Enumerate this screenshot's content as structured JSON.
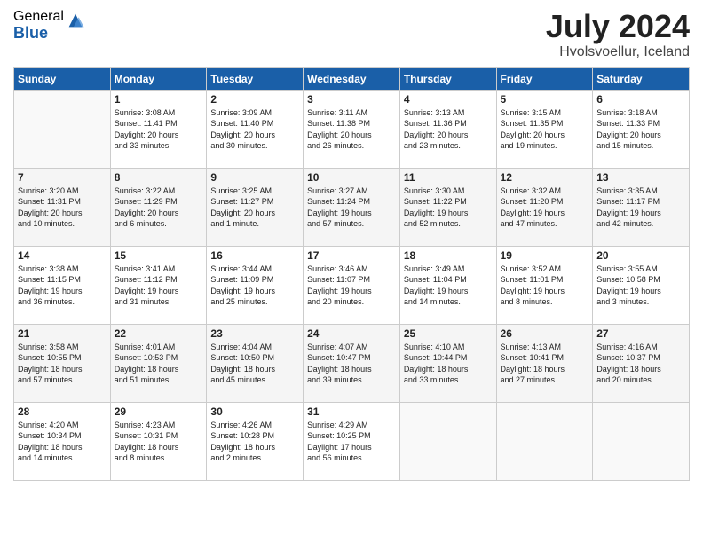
{
  "logo": {
    "general": "General",
    "blue": "Blue"
  },
  "header": {
    "month_year": "July 2024",
    "location": "Hvolsvoellur, Iceland"
  },
  "days_of_week": [
    "Sunday",
    "Monday",
    "Tuesday",
    "Wednesday",
    "Thursday",
    "Friday",
    "Saturday"
  ],
  "weeks": [
    [
      {
        "day": "",
        "info": ""
      },
      {
        "day": "1",
        "info": "Sunrise: 3:08 AM\nSunset: 11:41 PM\nDaylight: 20 hours\nand 33 minutes."
      },
      {
        "day": "2",
        "info": "Sunrise: 3:09 AM\nSunset: 11:40 PM\nDaylight: 20 hours\nand 30 minutes."
      },
      {
        "day": "3",
        "info": "Sunrise: 3:11 AM\nSunset: 11:38 PM\nDaylight: 20 hours\nand 26 minutes."
      },
      {
        "day": "4",
        "info": "Sunrise: 3:13 AM\nSunset: 11:36 PM\nDaylight: 20 hours\nand 23 minutes."
      },
      {
        "day": "5",
        "info": "Sunrise: 3:15 AM\nSunset: 11:35 PM\nDaylight: 20 hours\nand 19 minutes."
      },
      {
        "day": "6",
        "info": "Sunrise: 3:18 AM\nSunset: 11:33 PM\nDaylight: 20 hours\nand 15 minutes."
      }
    ],
    [
      {
        "day": "7",
        "info": "Sunrise: 3:20 AM\nSunset: 11:31 PM\nDaylight: 20 hours\nand 10 minutes."
      },
      {
        "day": "8",
        "info": "Sunrise: 3:22 AM\nSunset: 11:29 PM\nDaylight: 20 hours\nand 6 minutes."
      },
      {
        "day": "9",
        "info": "Sunrise: 3:25 AM\nSunset: 11:27 PM\nDaylight: 20 hours\nand 1 minute."
      },
      {
        "day": "10",
        "info": "Sunrise: 3:27 AM\nSunset: 11:24 PM\nDaylight: 19 hours\nand 57 minutes."
      },
      {
        "day": "11",
        "info": "Sunrise: 3:30 AM\nSunset: 11:22 PM\nDaylight: 19 hours\nand 52 minutes."
      },
      {
        "day": "12",
        "info": "Sunrise: 3:32 AM\nSunset: 11:20 PM\nDaylight: 19 hours\nand 47 minutes."
      },
      {
        "day": "13",
        "info": "Sunrise: 3:35 AM\nSunset: 11:17 PM\nDaylight: 19 hours\nand 42 minutes."
      }
    ],
    [
      {
        "day": "14",
        "info": "Sunrise: 3:38 AM\nSunset: 11:15 PM\nDaylight: 19 hours\nand 36 minutes."
      },
      {
        "day": "15",
        "info": "Sunrise: 3:41 AM\nSunset: 11:12 PM\nDaylight: 19 hours\nand 31 minutes."
      },
      {
        "day": "16",
        "info": "Sunrise: 3:44 AM\nSunset: 11:09 PM\nDaylight: 19 hours\nand 25 minutes."
      },
      {
        "day": "17",
        "info": "Sunrise: 3:46 AM\nSunset: 11:07 PM\nDaylight: 19 hours\nand 20 minutes."
      },
      {
        "day": "18",
        "info": "Sunrise: 3:49 AM\nSunset: 11:04 PM\nDaylight: 19 hours\nand 14 minutes."
      },
      {
        "day": "19",
        "info": "Sunrise: 3:52 AM\nSunset: 11:01 PM\nDaylight: 19 hours\nand 8 minutes."
      },
      {
        "day": "20",
        "info": "Sunrise: 3:55 AM\nSunset: 10:58 PM\nDaylight: 19 hours\nand 3 minutes."
      }
    ],
    [
      {
        "day": "21",
        "info": "Sunrise: 3:58 AM\nSunset: 10:55 PM\nDaylight: 18 hours\nand 57 minutes."
      },
      {
        "day": "22",
        "info": "Sunrise: 4:01 AM\nSunset: 10:53 PM\nDaylight: 18 hours\nand 51 minutes."
      },
      {
        "day": "23",
        "info": "Sunrise: 4:04 AM\nSunset: 10:50 PM\nDaylight: 18 hours\nand 45 minutes."
      },
      {
        "day": "24",
        "info": "Sunrise: 4:07 AM\nSunset: 10:47 PM\nDaylight: 18 hours\nand 39 minutes."
      },
      {
        "day": "25",
        "info": "Sunrise: 4:10 AM\nSunset: 10:44 PM\nDaylight: 18 hours\nand 33 minutes."
      },
      {
        "day": "26",
        "info": "Sunrise: 4:13 AM\nSunset: 10:41 PM\nDaylight: 18 hours\nand 27 minutes."
      },
      {
        "day": "27",
        "info": "Sunrise: 4:16 AM\nSunset: 10:37 PM\nDaylight: 18 hours\nand 20 minutes."
      }
    ],
    [
      {
        "day": "28",
        "info": "Sunrise: 4:20 AM\nSunset: 10:34 PM\nDaylight: 18 hours\nand 14 minutes."
      },
      {
        "day": "29",
        "info": "Sunrise: 4:23 AM\nSunset: 10:31 PM\nDaylight: 18 hours\nand 8 minutes."
      },
      {
        "day": "30",
        "info": "Sunrise: 4:26 AM\nSunset: 10:28 PM\nDaylight: 18 hours\nand 2 minutes."
      },
      {
        "day": "31",
        "info": "Sunrise: 4:29 AM\nSunset: 10:25 PM\nDaylight: 17 hours\nand 56 minutes."
      },
      {
        "day": "",
        "info": ""
      },
      {
        "day": "",
        "info": ""
      },
      {
        "day": "",
        "info": ""
      }
    ]
  ]
}
